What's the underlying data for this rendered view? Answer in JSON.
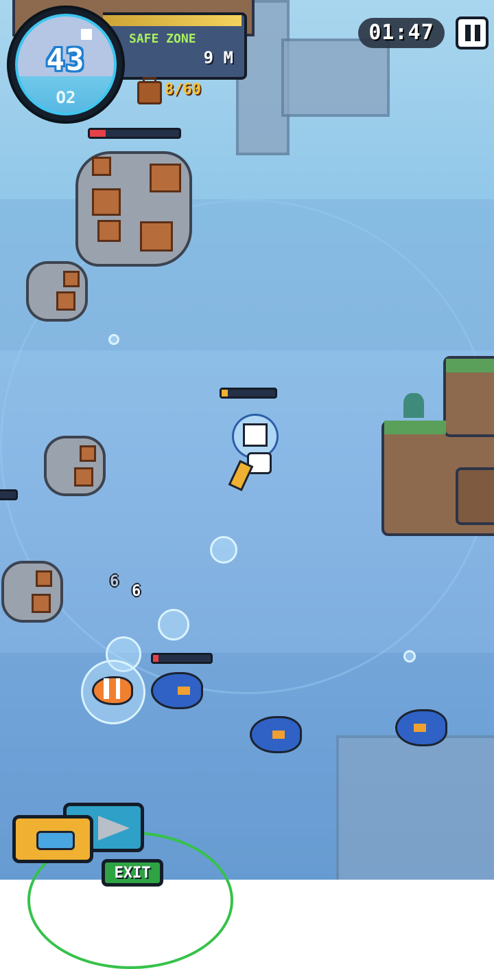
{
  "hud": {
    "oxygen_value": "43",
    "oxygen_label": "O2",
    "zone_name": "SAFE ZONE",
    "depth": "9 M",
    "cargo": "8/60",
    "timer": "01:47"
  },
  "floating_numbers": [
    "6",
    "6"
  ],
  "buttons": {
    "exit_label": "EXIT"
  },
  "colors": {
    "water": "#8bb9e6",
    "oxygen_ring": "#3ec6f0",
    "zone_text": "#a8f060",
    "cargo_text": "#f5c23a",
    "health_red": "#e5414a"
  },
  "icons": [
    "backpack-icon",
    "pause-icon",
    "bubble-gun-icon",
    "drill-icon"
  ]
}
